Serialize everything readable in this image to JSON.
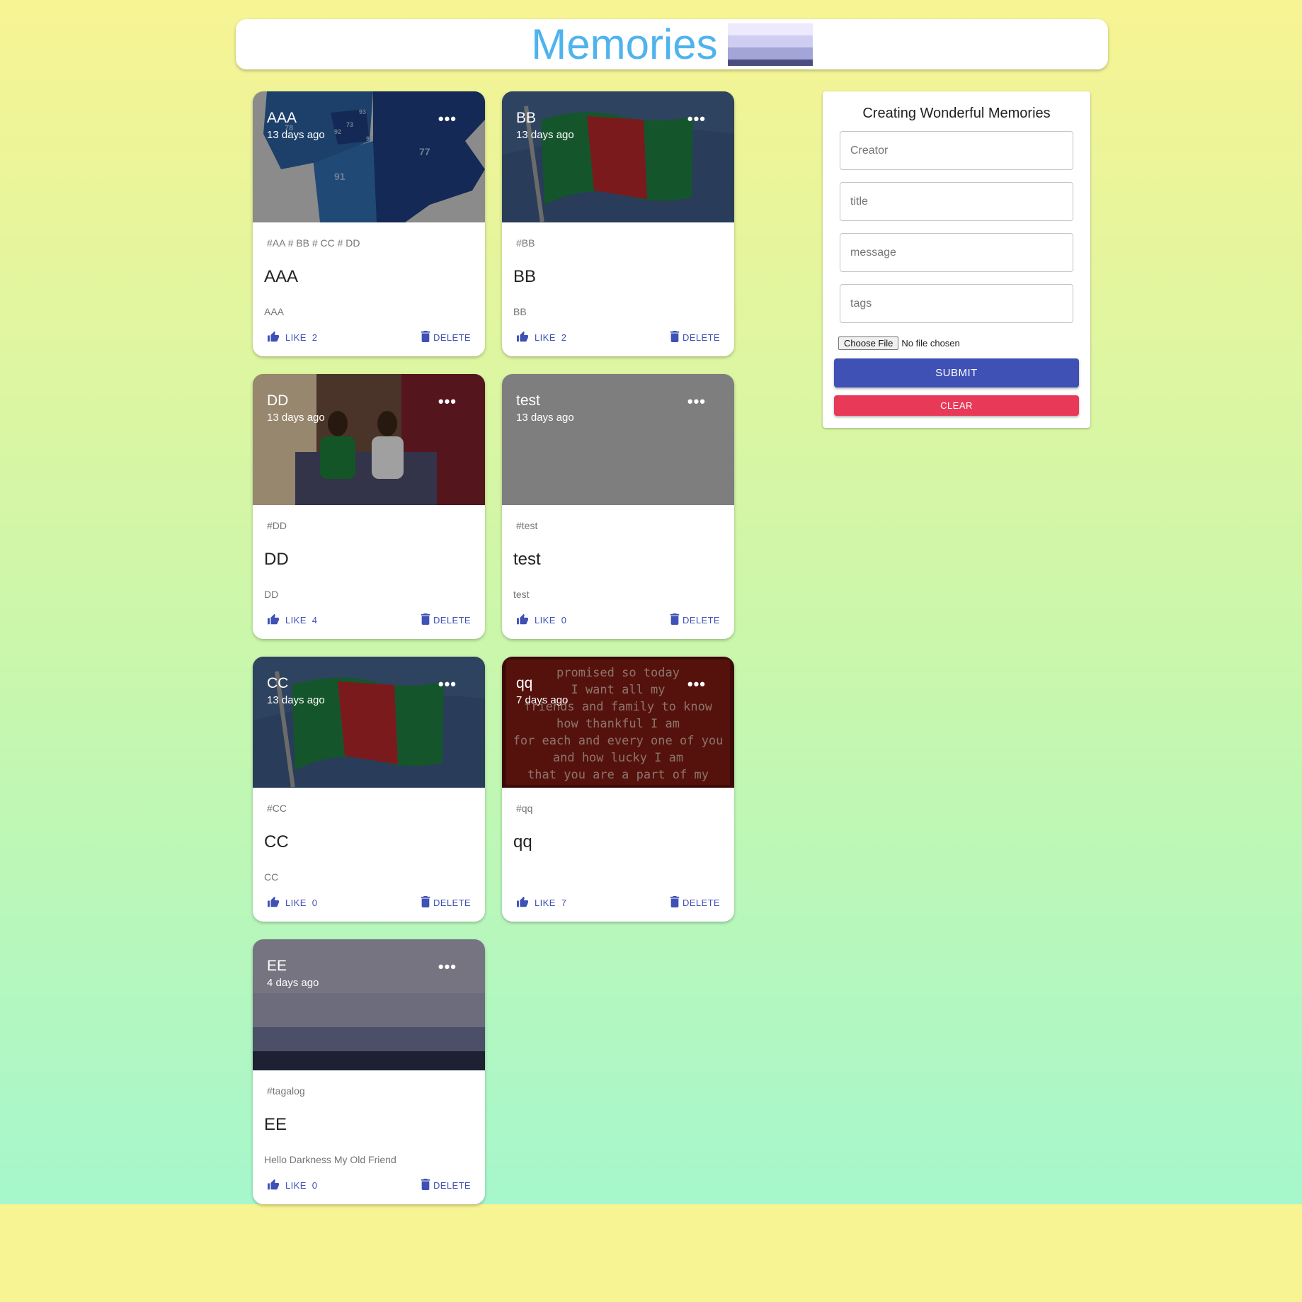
{
  "app": {
    "title": "Memories"
  },
  "colors": {
    "accent": "#3f51b5",
    "clear": "#e83a58",
    "brand": "#4fb3ee",
    "logo_bands": [
      "#eceafc",
      "#cfcdf1",
      "#a3a4d8",
      "#4a4e7e"
    ]
  },
  "posts": [
    {
      "creator": "AAA",
      "time": "13 days ago",
      "tags": "#AA # BB # CC # DD",
      "title": "AAA",
      "message": "AAA",
      "like_label": "LIKE",
      "likes": "2",
      "delete_label": "DELETE",
      "more": "•••",
      "image": "map"
    },
    {
      "creator": "BB",
      "time": "13 days ago",
      "tags": "#BB",
      "title": "BB",
      "message": "BB",
      "like_label": "LIKE",
      "likes": "2",
      "delete_label": "DELETE",
      "more": "•••",
      "image": "flag"
    },
    {
      "creator": "DD",
      "time": "13 days ago",
      "tags": "#DD",
      "title": "DD",
      "message": "DD",
      "like_label": "LIKE",
      "likes": "4",
      "delete_label": "DELETE",
      "more": "•••",
      "image": "photo"
    },
    {
      "creator": "test",
      "time": "13 days ago",
      "tags": "#test",
      "title": "test",
      "message": "test",
      "like_label": "LIKE",
      "likes": "0",
      "delete_label": "DELETE",
      "more": "•••",
      "image": "blank"
    },
    {
      "creator": "CC",
      "time": "13 days ago",
      "tags": "#CC",
      "title": "CC",
      "message": "CC",
      "like_label": "LIKE",
      "likes": "0",
      "delete_label": "DELETE",
      "more": "•••",
      "image": "flag"
    },
    {
      "creator": "qq",
      "time": "7 days ago",
      "tags": "#qq",
      "title": "qq",
      "message": "",
      "like_label": "LIKE",
      "likes": "7",
      "delete_label": "DELETE",
      "more": "•••",
      "image": "quote"
    },
    {
      "creator": "EE",
      "time": "4 days ago",
      "tags": "#tagalog",
      "title": "EE",
      "message": "Hello Darkness My Old Friend",
      "like_label": "LIKE",
      "likes": "0",
      "delete_label": "DELETE",
      "more": "•••",
      "image": "stripes"
    }
  ],
  "quote_lines": [
    "promised so today",
    "I want all my",
    "friends and family to know",
    "how thankful I am",
    "for each and every one of you",
    "and how lucky I am",
    "that you are a part of my"
  ],
  "map_labels": [
    "77",
    "91",
    "93",
    "73",
    "92",
    "94",
    "78"
  ],
  "form": {
    "title": "Creating Wonderful Memories",
    "creator_placeholder": "Creator",
    "title_placeholder": "title",
    "message_placeholder": "message",
    "tags_placeholder": "tags",
    "file_button": "Choose File",
    "file_status": "No file chosen",
    "submit_label": "SUBMIT",
    "clear_label": "CLEAR"
  }
}
